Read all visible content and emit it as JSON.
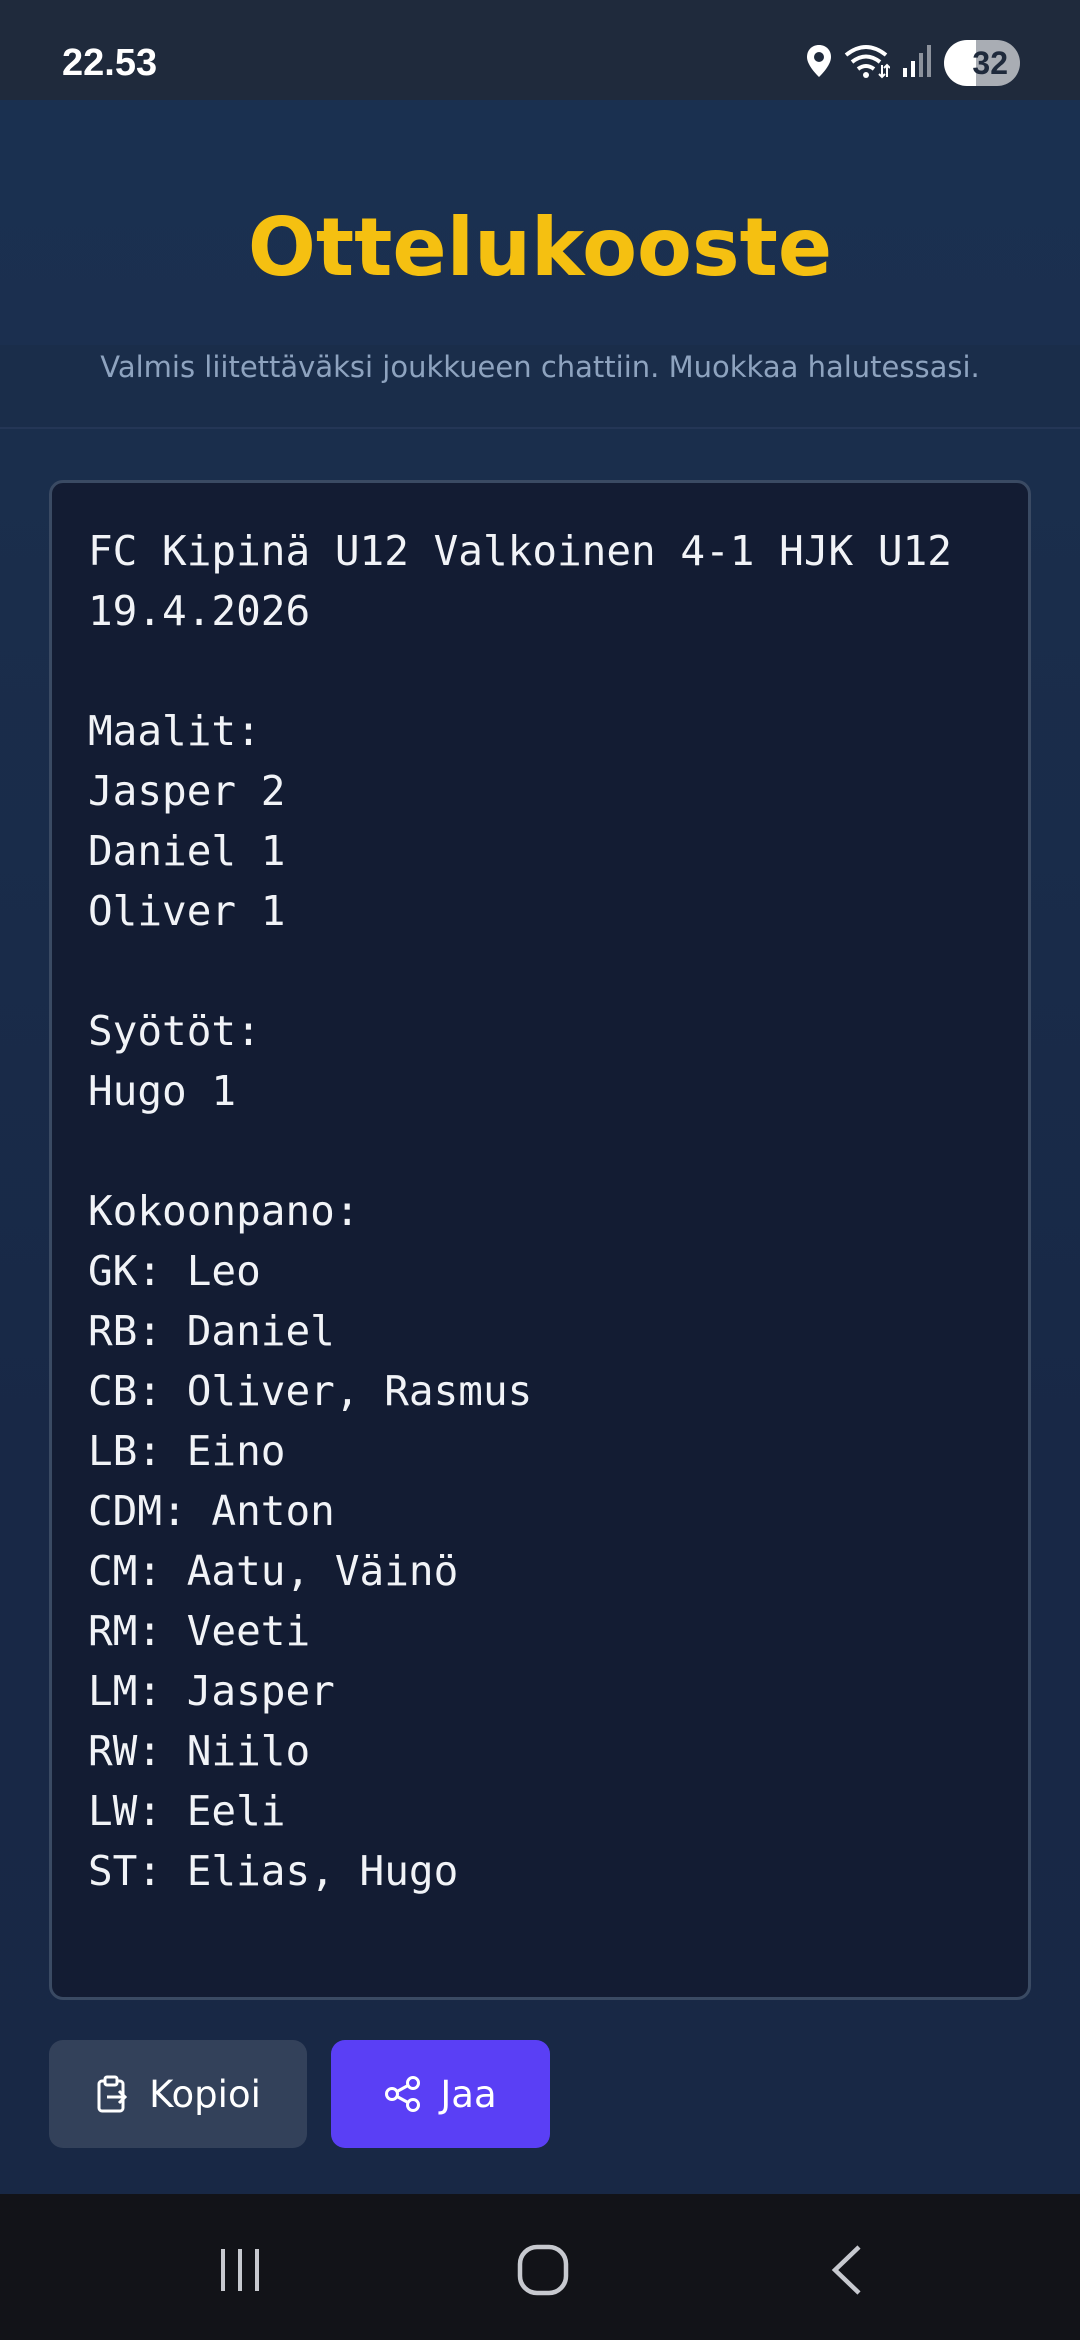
{
  "status_bar": {
    "time": "22.53",
    "battery": "32",
    "icons": [
      "location-icon",
      "wifi-icon",
      "signal-icon",
      "battery-icon"
    ]
  },
  "header": {
    "title": "Ottelukooste",
    "subtitle": "Valmis liitettäväksi joukkueen chattiin. Muokkaa halutessasi."
  },
  "summary": {
    "text": "FC Kipinä U12 Valkoinen 4-1 HJK U12\n19.4.2026\n\nMaalit:\nJasper 2\nDaniel 1\nOliver 1\n\nSyötöt:\nHugo 1\n\nKokoonpano:\nGK: Leo\nRB: Daniel\nCB: Oliver, Rasmus\nLB: Eino\nCDM: Anton\nCM: Aatu, Väinö\nRM: Veeti\nLM: Jasper\nRW: Niilo\nLW: Eeli\nST: Elias, Hugo"
  },
  "actions": {
    "copy_label": "Kopioi",
    "share_label": "Jaa"
  },
  "navigation": {
    "items": [
      "recent-apps-icon",
      "home-icon",
      "back-icon"
    ]
  },
  "colors": {
    "title": "#f5c011",
    "share_button": "#5a3ff5",
    "copy_button": "#33415a",
    "background": "#182846"
  }
}
